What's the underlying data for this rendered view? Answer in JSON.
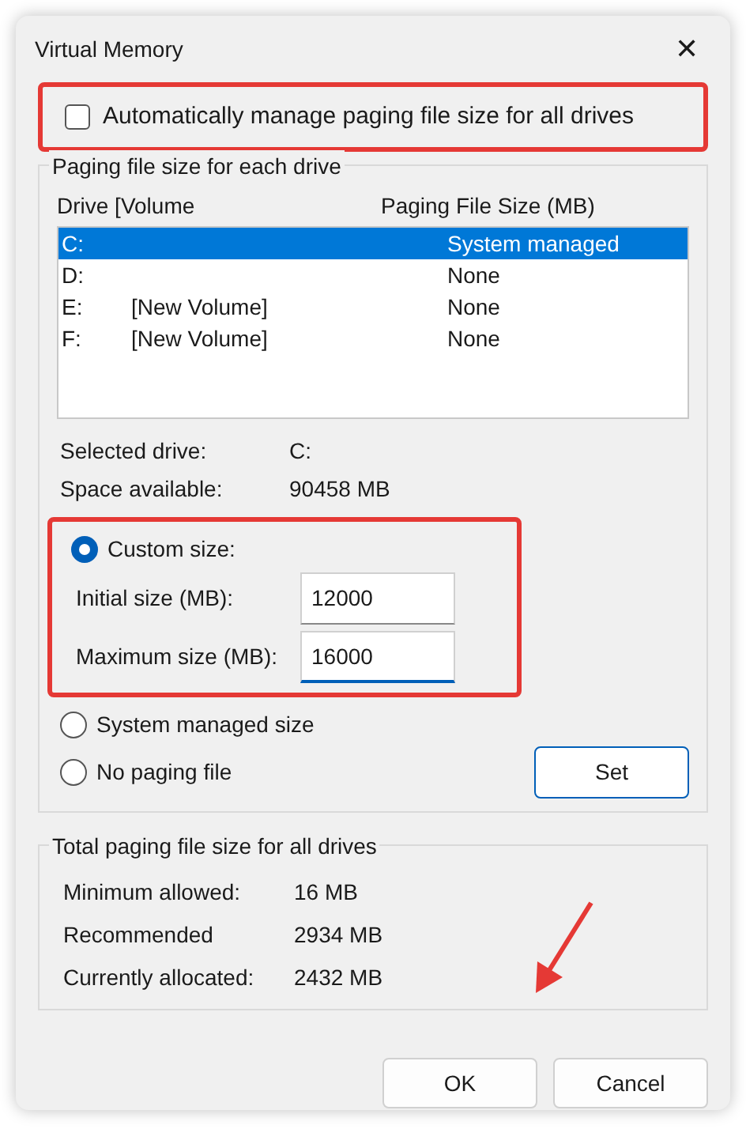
{
  "window": {
    "title": "Virtual Memory",
    "close": "✕"
  },
  "auto_manage": {
    "label": "Automatically manage paging file size for all drives",
    "checked": false,
    "highlighted": true
  },
  "drives_group": {
    "title": "Paging file size for each drive",
    "columns": [
      "Drive  [Volume",
      "Paging File Size (MB)"
    ],
    "rows": [
      {
        "drive": "C:",
        "volume": "",
        "size": "System managed",
        "selected": true
      },
      {
        "drive": "D:",
        "volume": "",
        "size": "None",
        "selected": false
      },
      {
        "drive": "E:",
        "volume": "[New Volume]",
        "size": "None",
        "selected": false
      },
      {
        "drive": "F:",
        "volume": "[New Volume]",
        "size": "None",
        "selected": false
      }
    ],
    "info": [
      {
        "label": "Selected drive:",
        "value": "C:"
      },
      {
        "label": "Space available:",
        "value": "90458 MB"
      }
    ],
    "custom": {
      "label": "Custom size:",
      "selected": true,
      "highlighted": true,
      "fields": [
        {
          "label": "Initial size (MB):",
          "value": "12000",
          "focused": false
        },
        {
          "label": "Maximum size (MB):",
          "value": "16000",
          "focused": true
        }
      ]
    },
    "options": [
      {
        "label": "System managed size",
        "selected": false
      },
      {
        "label": "No paging file",
        "selected": false
      }
    ],
    "set_button": "Set"
  },
  "totals_group": {
    "title": "Total paging file size for all drives",
    "rows": [
      {
        "label": "Minimum allowed:",
        "value": "16 MB"
      },
      {
        "label": "Recommended",
        "value": "2934 MB"
      },
      {
        "label": "Currently allocated:",
        "value": "2432 MB"
      }
    ]
  },
  "buttons": [
    "OK",
    "Cancel"
  ],
  "annotation_arrow": true
}
